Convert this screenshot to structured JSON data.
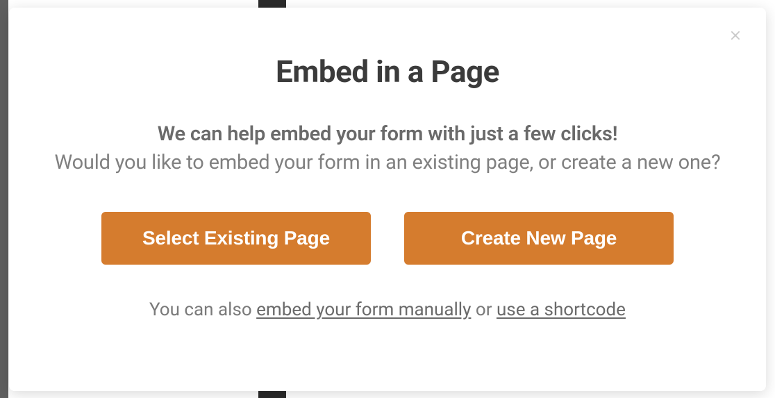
{
  "modal": {
    "title": "Embed in a Page",
    "lead": "We can help embed your form with just a few clicks!",
    "subtext": "Would you like to embed your form in an existing page, or create a new one?",
    "buttons": {
      "existing": "Select Existing Page",
      "create": "Create New Page"
    },
    "helper": {
      "prefix": "You can also ",
      "link_manual": "embed your form manually",
      "middle": " or ",
      "link_shortcode": "use a shortcode"
    }
  }
}
